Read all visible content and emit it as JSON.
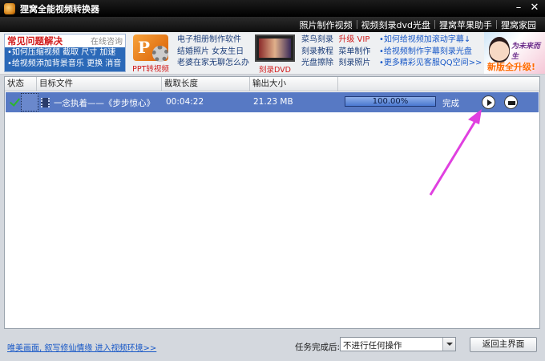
{
  "window": {
    "title": "狸窝全能视频转换器"
  },
  "menu": [
    "照片制作视频",
    "视频刻录dvd光盘",
    "狸窝苹果助手",
    "狸窝家园"
  ],
  "banner": {
    "faq_title": "常见问题解决",
    "faq_online": "在线咨询",
    "faq_line1": "•如何压缩视频  截取  尺寸  加速",
    "faq_line2": "•给视频添加背景音乐  更换  消音",
    "ppt_caption": "PPT转视频",
    "col1": [
      "电子相册制作软件",
      "结婚照片  女友生日",
      "老婆在家无聊怎么办"
    ],
    "dvd_caption": "刻录DVD",
    "col2_a": [
      "菜鸟刻录",
      "刻录教程",
      "光盘擦除"
    ],
    "col2_vip": "升级 VIP",
    "col2_b": [
      "菜单制作",
      "刻录照片"
    ],
    "col3": [
      "•如何给视频加滚动字幕↓",
      "•给视频制作字幕刻录光盘",
      "•更多精彩见客服QQ空间>>"
    ],
    "promo_caption": "新版全升级!",
    "promo_logo": "为未来而生"
  },
  "table": {
    "headers": [
      "状态",
      "目标文件",
      "截取长度",
      "输出大小"
    ],
    "rows": [
      {
        "file": "一念执着——《步步惊心》",
        "length": "00:04:22",
        "size": "21.23 MB",
        "progress_percent": 100,
        "progress_text": "100.00%",
        "status": "完成"
      }
    ]
  },
  "footer": {
    "link": "唯美画面, 叙写修仙情缘 进入视频环境>>",
    "task_label": "任务完成后:",
    "task_option": "不进行任何操作",
    "home_button": "返回主界面"
  },
  "colors": {
    "accent": "#5779c4",
    "annotation_arrow": "#e040e0"
  }
}
